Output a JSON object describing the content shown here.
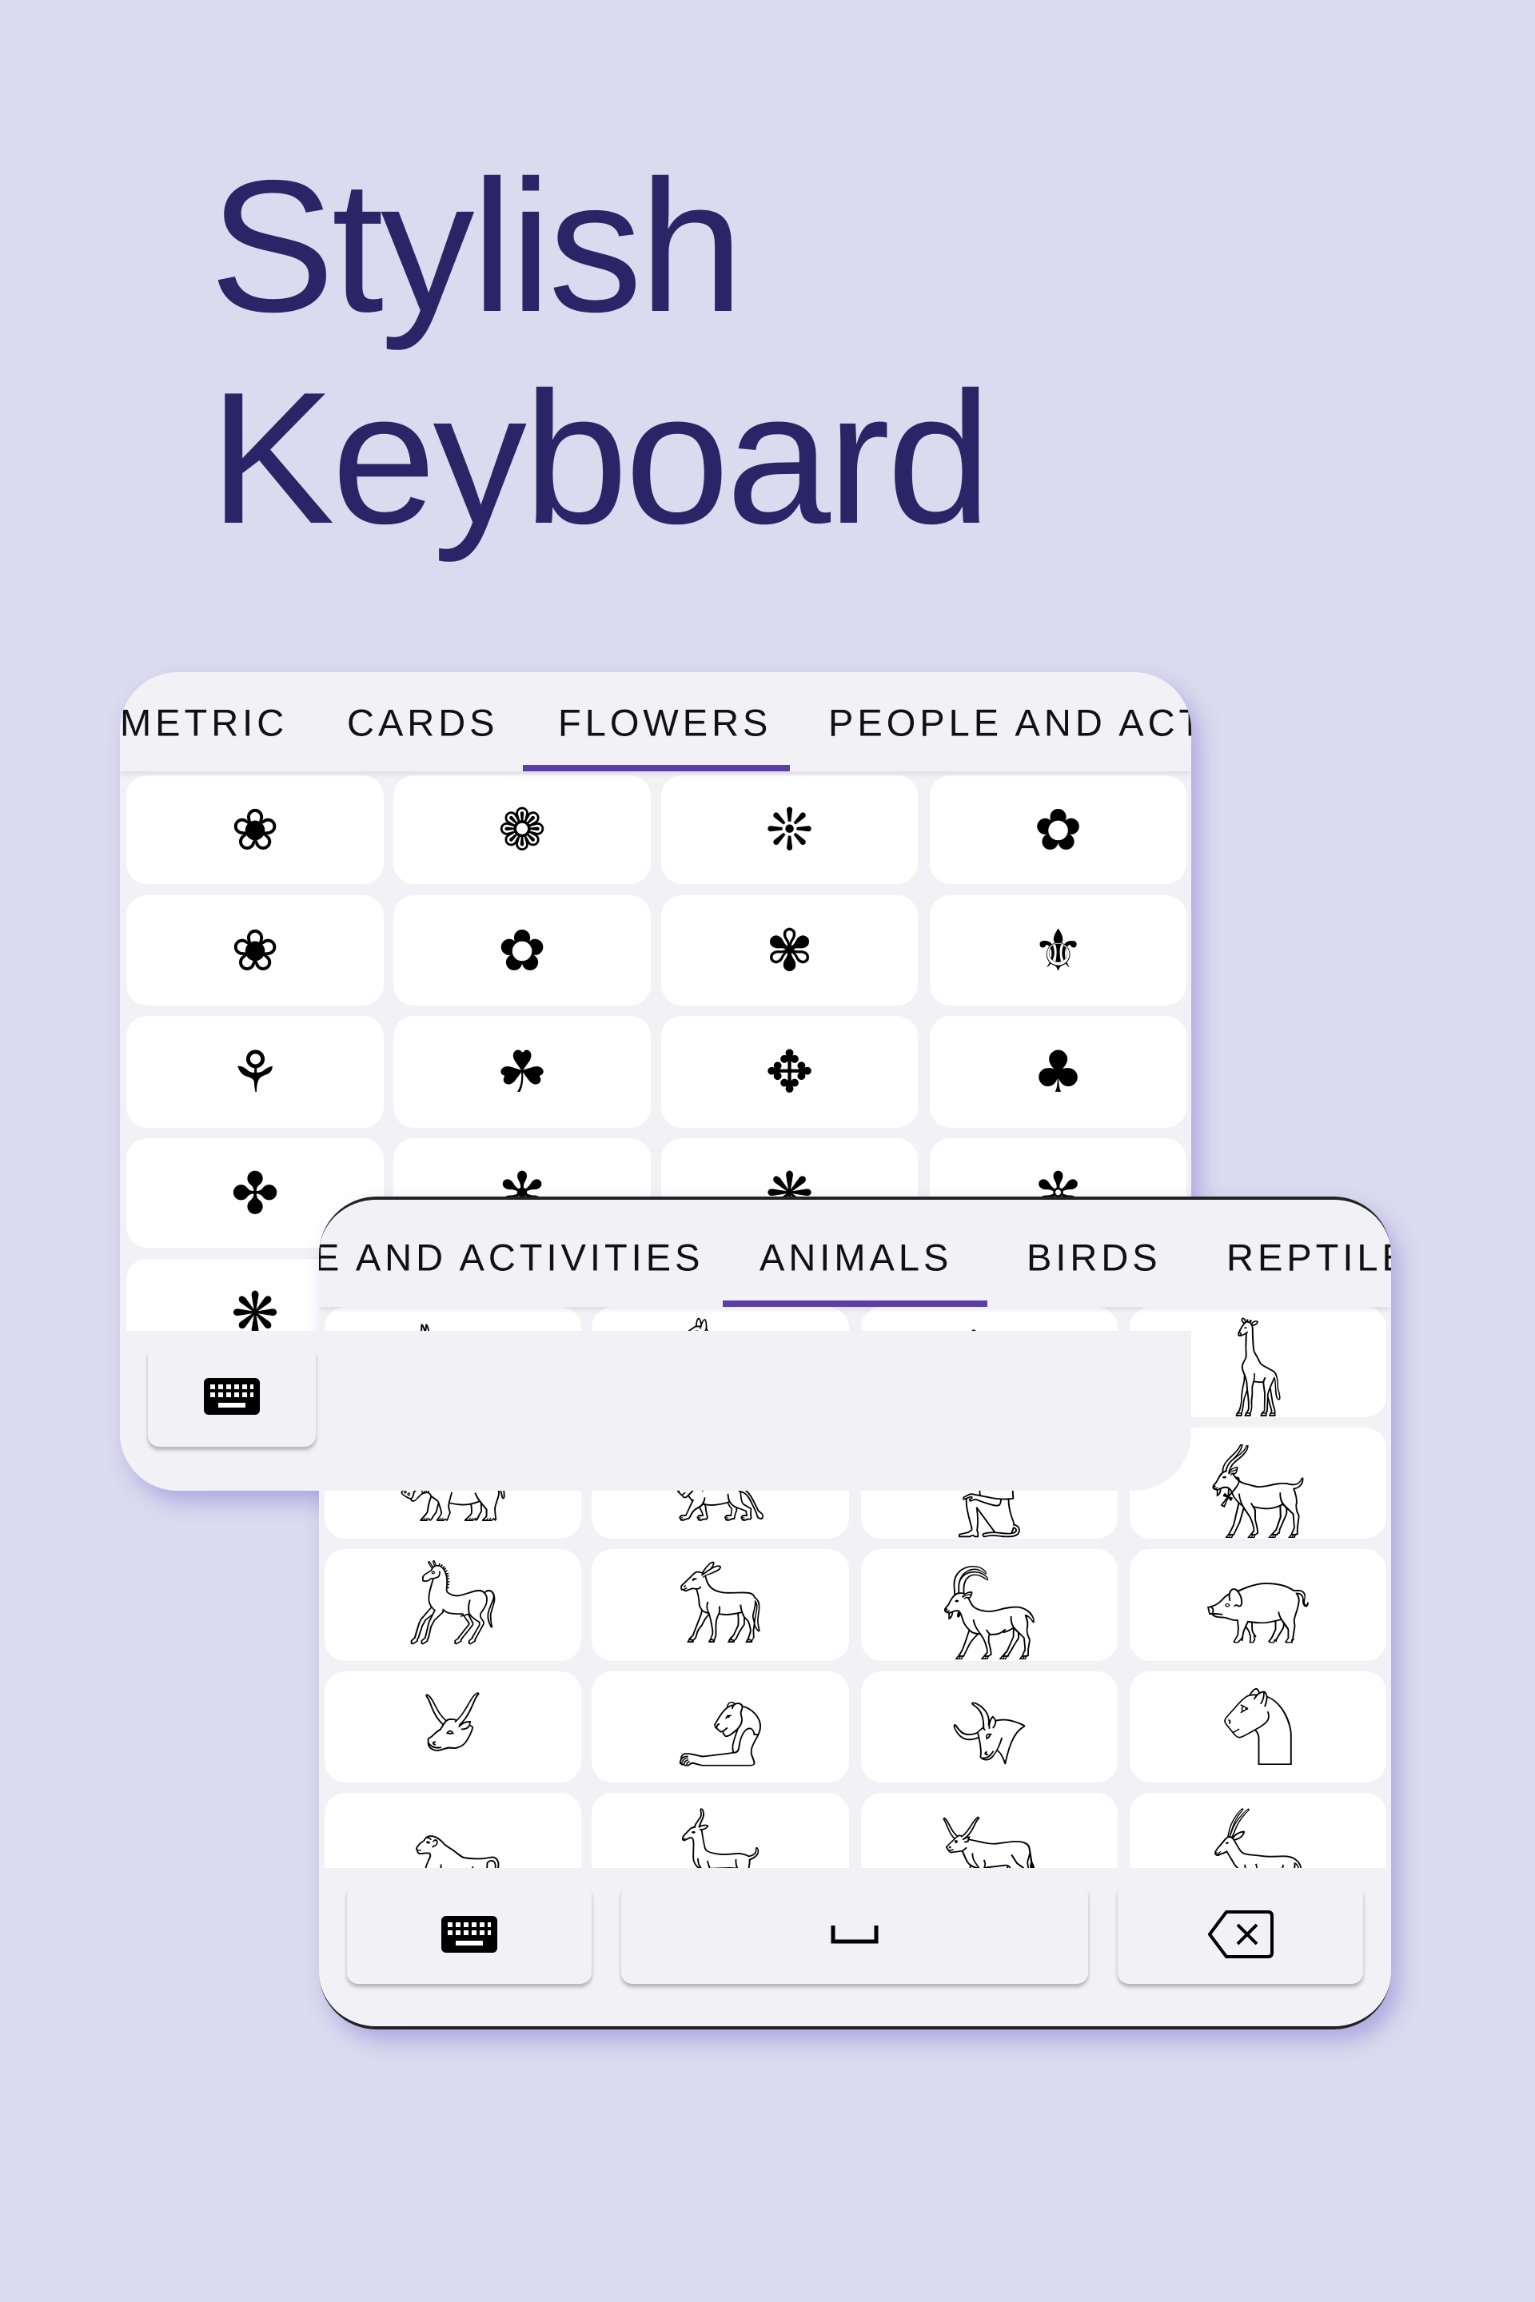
{
  "headline": {
    "line1": "Stylish",
    "line2": "Keyboard",
    "color": "#2a2566"
  },
  "accent_color": "#5b3fa6",
  "keyboard_back": {
    "tabs": [
      "METRIC",
      "CARDS",
      "FLOWERS",
      "PEOPLE AND ACT"
    ],
    "active_tab": "FLOWERS",
    "symbols": [
      "❀",
      "❁",
      "❊",
      "✿",
      "❀",
      "✿",
      "✾",
      "⚜",
      "⚘",
      "☘",
      "✥",
      "♣",
      "✤",
      "✻",
      "❋",
      "✼",
      "❋"
    ],
    "bottom_keys": {
      "keyboard_icon": "keyboard-icon"
    }
  },
  "keyboard_front": {
    "tabs": [
      "E AND ACTIVITIES",
      "ANIMALS",
      "BIRDS",
      "REPTILE"
    ],
    "active_tab": "ANIMALS",
    "symbols": [
      "𓃥",
      "𓃠",
      "𓃰",
      "𓃱",
      "𓃯",
      "𓃬",
      "𓃻",
      "𓃶",
      "𓃗",
      "𓃘",
      "𓃵",
      "𓃟",
      "𓃾",
      "𓄂",
      "𓄀",
      "𓄇",
      "𓃷",
      "𓃴",
      "𓃽",
      "𓃲"
    ],
    "bottom_keys": {
      "keyboard_icon": "keyboard-icon",
      "space_icon": "space-bar-icon",
      "backspace_icon": "backspace-icon"
    }
  }
}
